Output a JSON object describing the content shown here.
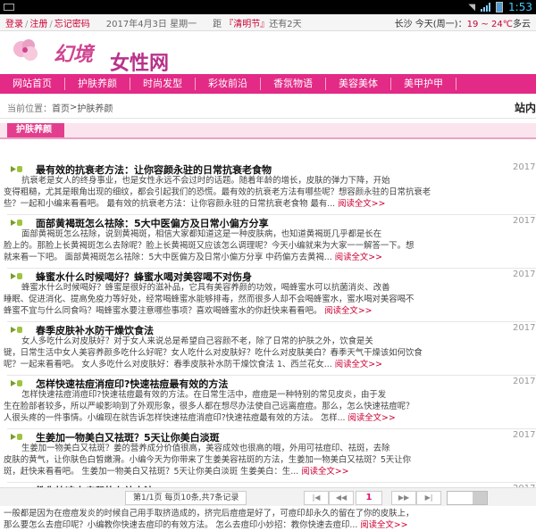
{
  "status_bar": {
    "time": "1:53"
  },
  "top_bar": {
    "login": "登录",
    "register": "注册",
    "forgot_password": "忘记密码",
    "date": "2017年4月3日 星期一",
    "countdown_prefix": "距",
    "countdown_festival": "『清明节』",
    "countdown_suffix": "还有2天",
    "weather_city": "长沙",
    "weather_day": "今天(周一)：",
    "weather_temp": "19 ~ 24℃",
    "weather_desc": "多云"
  },
  "logo": {
    "text_part1": "幻境",
    "text_part2": "女性网"
  },
  "nav": {
    "items": [
      "网站首页",
      "护肤养颜",
      "时尚发型",
      "彩妆前沿",
      "香氛物语",
      "美容美体",
      "美甲护甲"
    ]
  },
  "breadcrumb": {
    "label": "当前位置：",
    "home": "首页",
    "separator": " > ",
    "current": "护肤养颜",
    "site_right": "站内"
  },
  "section": {
    "title": "护肤养颜"
  },
  "articles": [
    {
      "title": "最有效的抗衰老方法：让你容颜永驻的日常抗衰老食物",
      "date": "2017",
      "summary": [
        "抗衰老是女人的终身事业，也是女性永远不会过时的话题。随着年龄的增长，皮肤的弹力下降，开始",
        "变得粗糙，尤其是眼角出现的细纹，都会引起我们的恐慌。最有效的抗衰老方法有哪些呢？想容颜永驻的日常抗衰老",
        "些？一起和小编来看看吧。          最有效的抗衰老方法：让你容颜永驻的日常抗衰老食物 最有..."
      ],
      "more": "阅读全文>>"
    },
    {
      "title": "面部黄褐斑怎么祛除：5大中医偏方及日常小偏方分享",
      "date": "2017",
      "summary": [
        "面部黄褐斑怎么祛除，说到黄褐斑，相信大家都知道这是一种皮肤病，也知道黄褐斑几乎都是长在",
        "脸上的。那脸上长黄褐斑怎么去除呢？脸上长黄褐斑又应该怎么调理呢？今天小编就来为大家一一解答一下。想",
        "就来看一下吧。 面部黄褐斑怎么祛除：5大中医偏方及日常小偏方分享    中药偏方去黄褐..."
      ],
      "more": "阅读全文>>"
    },
    {
      "title": "蜂蜜水什么时候喝好？蜂蜜水喝对美容喝不对伤身",
      "date": "2017",
      "summary": [
        "蜂蜜水什么时候喝好？蜂蜜是很好的滋补品，它具有美容养颜的功效，喝蜂蜜水可以抗菌消炎、改善",
        "睡眠、促进消化、提高免疫力等好处，经常喝蜂蜜水能够排毒，然而很多人却不会喝蜂蜜水，蜜水喝对美容喝不",
        "蜂蜜不宜与什么同食吗？喝蜂蜜水要注意哪些事项？喜欢喝蜂蜜水的你赶快来看看吧。"
      ],
      "more": "阅读全文>>"
    },
    {
      "title": "春季皮肤补水防干燥饮食法",
      "date": "2017",
      "summary": [
        "女人多吃什么对皮肤好？对于女人来说总是希望自己容颜不老，除了日常的护肤之外，饮食是关",
        "键，日常生活中女人美容养颜多吃什么好呢？女人吃什么对皮肤好？吃什么对皮肤美白？春季天气干燥该如何饮食",
        "呢？一起来看看吧。         女人多吃什么对皮肤好：春季皮肤补水防干燥饮食法    1、西兰花女..."
      ],
      "more": "阅读全文>>"
    },
    {
      "title": "怎样快速祛痘消痘印?快速祛痘最有效的方法",
      "date": "2017",
      "summary": [
        "怎样快速祛痘消痘印?快速祛痘最有效的方法。在日常生活中，痘痘是一种特别的常见皮炎，由于发",
        "生在脸部者较多，所以严峻影响到了外观形象，很多人都在想尽办法使自己远离痘痘。那么，怎么快速祛痘呢？",
        "人很头疼的一件事情。小编现在就告诉怎样快速祛痘消痘印?快速祛痘最有效的方法。 怎样..."
      ],
      "more": "阅读全文>>"
    },
    {
      "title": "生姜加一物美白又祛斑？5天让你美白淡斑",
      "date": "2017",
      "summary": [
        "生姜加一物美白又祛斑？姜的营养成分价值很高，美容成效也很高的哦，外用可祛痘印、祛斑，去除",
        "皮肤的黄气，让你肤色白皙嫩滑。小编今天为你带来了生姜美容祛斑的方法，生姜加一物美白又祛斑？5天让你",
        "斑，赶快来看看吧。     生姜加一物美白又祛斑？5天让你美白淡斑    生姜美白：生..."
      ],
      "more": "阅读全文>>"
    },
    {
      "title": "教你快速去痘印的有效方法",
      "date": "2017",
      "summary": [
        "怎么去痘印，去痘印小妙招，教你快速去痘印的有效方法。很多痘痘消除后都会留下难看的痘印，",
        "一般都是因为在痘痘发炎的时候自己用手取挤造成的，挤完后痘痘是好了，可痘印却永久的留在了你的皮肤上，",
        "那么要怎么去痘印呢？小编教你快速去痘印的有效方法。 怎么去痘印小妙招：教你快速去痘印..."
      ],
      "more": "阅读全文>>"
    }
  ],
  "pager": {
    "info": "第1/1页 每页10条,共7条记录",
    "first": "|◀",
    "prev": "◀◀",
    "page": "1",
    "next": "▶▶",
    "last": "▶|"
  }
}
